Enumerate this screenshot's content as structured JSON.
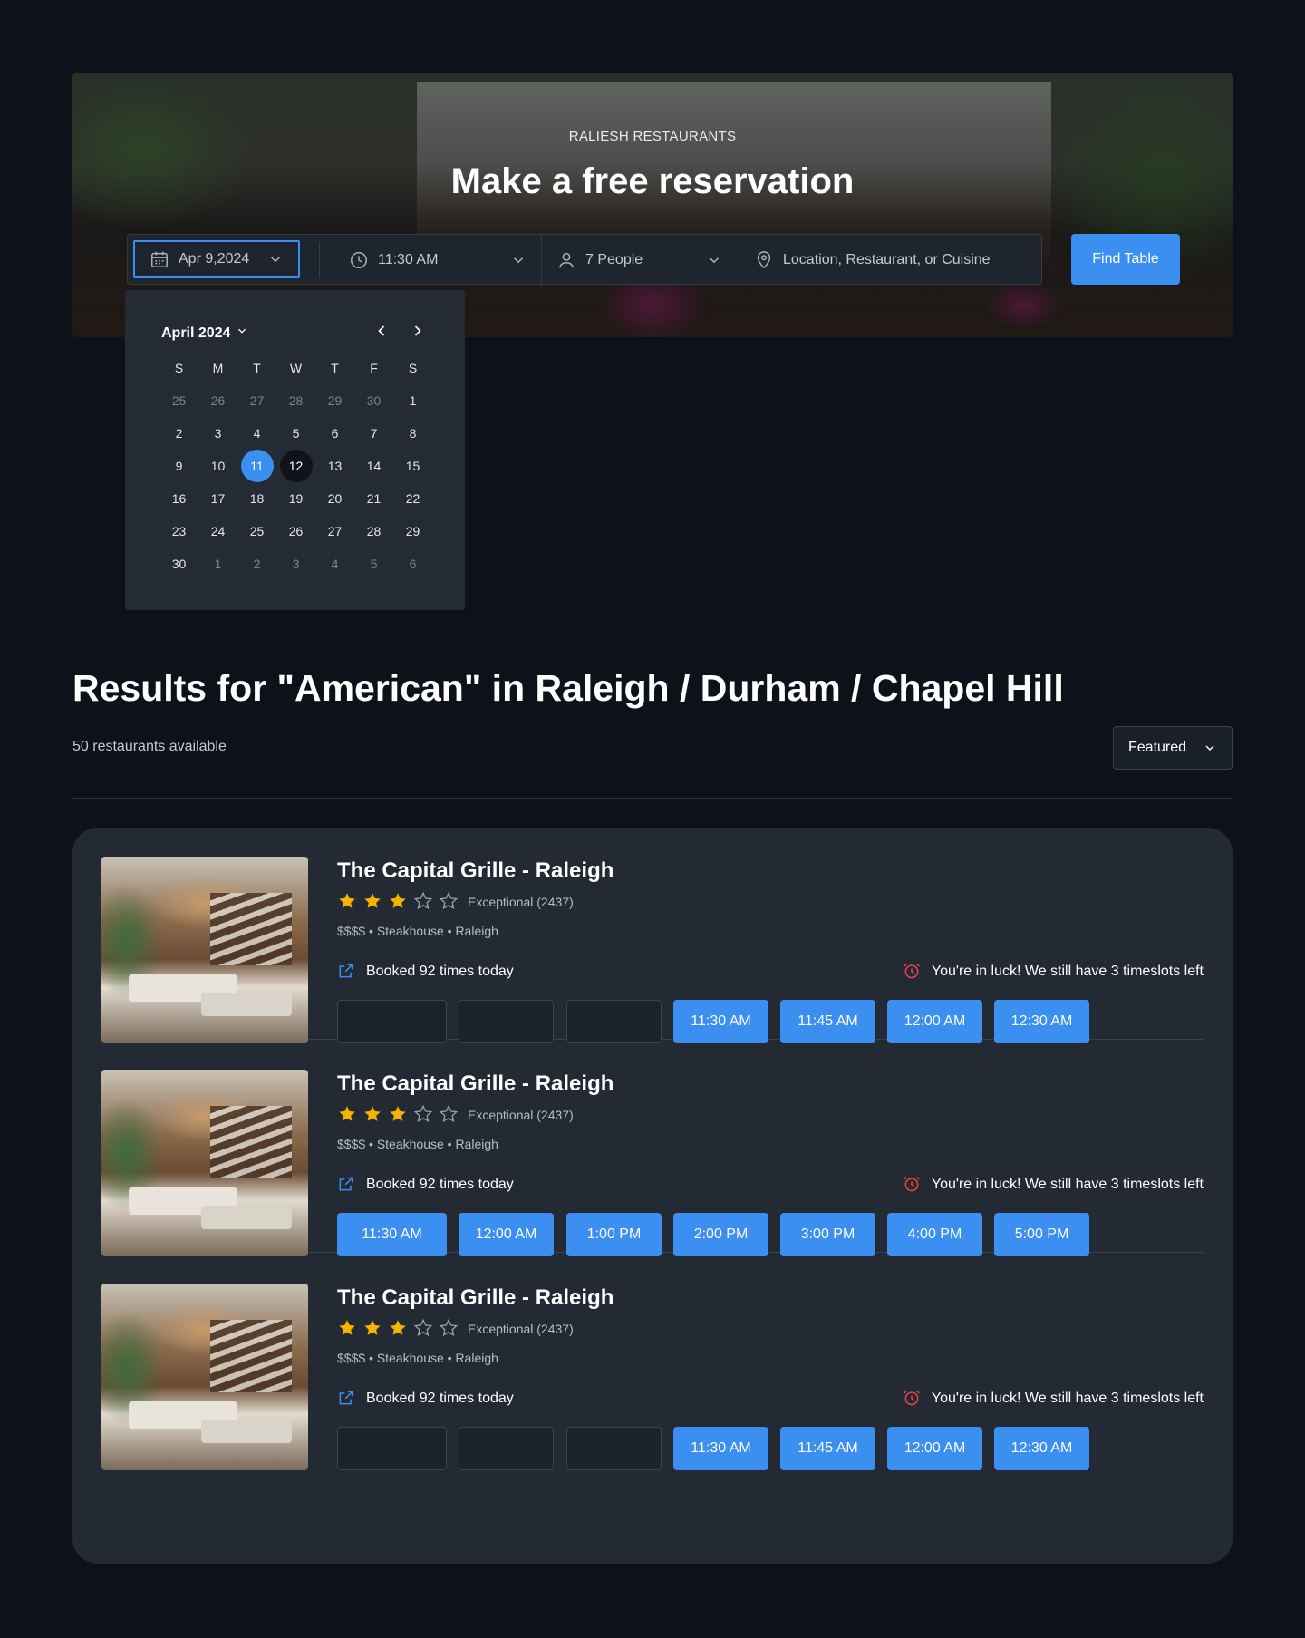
{
  "hero": {
    "eyebrow": "RALIESH RESTAURANTS",
    "title": "Make a free reservation"
  },
  "search": {
    "date": "Apr 9,2024",
    "time": "11:30 AM",
    "people": "7 People",
    "location_placeholder": "Location, Restaurant, or Cuisine",
    "find_label": "Find Table",
    "icons": {
      "date": "calendar-icon",
      "time": "clock-icon",
      "people": "person-icon",
      "location": "map-pin-icon"
    }
  },
  "calendar": {
    "month_label": "April 2024",
    "weekdays": [
      "S",
      "M",
      "T",
      "W",
      "T",
      "F",
      "S"
    ],
    "days": [
      [
        "25",
        "26",
        "27",
        "28",
        "29",
        "30",
        "1"
      ],
      [
        "2",
        "3",
        "4",
        "5",
        "6",
        "7",
        "8"
      ],
      [
        "9",
        "10",
        "11",
        "12",
        "13",
        "14",
        "15"
      ],
      [
        "16",
        "17",
        "18",
        "19",
        "20",
        "21",
        "22"
      ],
      [
        "23",
        "24",
        "25",
        "26",
        "27",
        "28",
        "29"
      ],
      [
        "30",
        "1",
        "2",
        "3",
        "4",
        "5",
        "6"
      ]
    ],
    "selected_day": "11",
    "highlighted_day": "12"
  },
  "results": {
    "title": "Results for \"American\" in Raleigh / Durham / Chapel Hill",
    "count": "50 restaurants available",
    "sort_label": "Featured"
  },
  "restaurants": [
    {
      "name": "The Capital Grille - Raleigh",
      "stars_filled": 3,
      "stars_total": 5,
      "rating": "Exceptional (2437)",
      "meta": "$$$$ • Steakhouse • Raleigh",
      "booked": "Booked 92 times today",
      "luck": "You're in luck! We still have 3 timeslots left",
      "slots": [
        "",
        "",
        "",
        "11:30 AM",
        "11:45 AM",
        "12:00 AM",
        "12:30 AM"
      ]
    },
    {
      "name": "The Capital Grille - Raleigh",
      "stars_filled": 3,
      "stars_total": 5,
      "rating": "Exceptional (2437)",
      "meta": "$$$$ • Steakhouse • Raleigh",
      "booked": "Booked 92 times today",
      "luck": "You're in luck! We still have 3 timeslots left",
      "slots": [
        "11:30 AM",
        "12:00 AM",
        "1:00 PM",
        "2:00 PM",
        "3:00 PM",
        "4:00 PM",
        "5:00 PM"
      ]
    },
    {
      "name": "The Capital Grille - Raleigh",
      "stars_filled": 3,
      "stars_total": 5,
      "rating": "Exceptional (2437)",
      "meta": "$$$$ • Steakhouse • Raleigh",
      "booked": "Booked 92 times today",
      "luck": "You're in luck! We still have 3 timeslots left",
      "slots": [
        "",
        "",
        "",
        "11:30 AM",
        "11:45 AM",
        "12:00 AM",
        "12:30 AM"
      ]
    }
  ],
  "colors": {
    "background": "#0d121a",
    "panel": "#232a33",
    "accent": "#3b8ff0",
    "star": "#f5b400",
    "alert": "#ef4444"
  }
}
